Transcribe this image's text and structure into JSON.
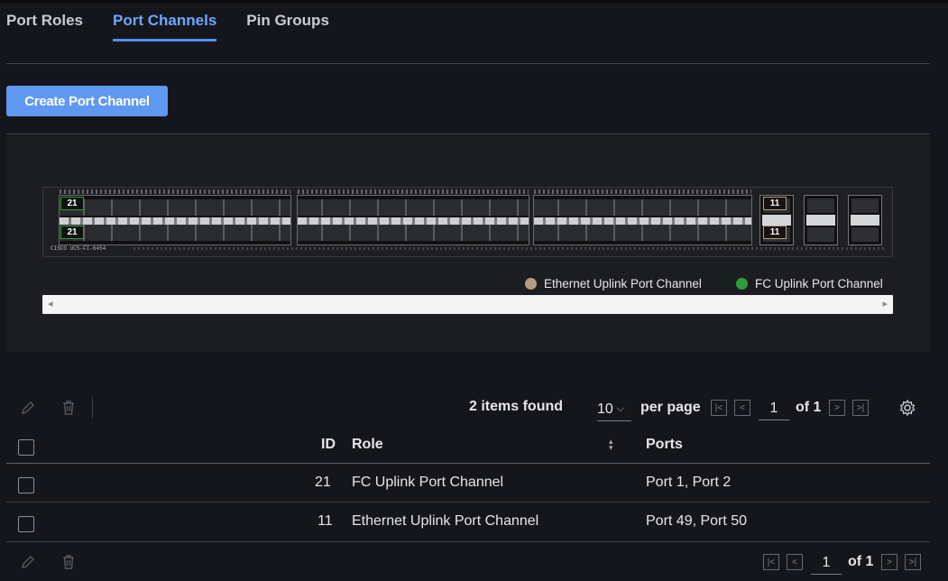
{
  "tabs": [
    {
      "label": "Port Roles",
      "active": false
    },
    {
      "label": "Port Channels",
      "active": true
    },
    {
      "label": "Pin Groups",
      "active": false
    }
  ],
  "create_button": "Create Port Channel",
  "switch": {
    "model": "CISCO UCS-FI-6454",
    "pc_tags": {
      "fc_top": "21",
      "fc_bottom": "21",
      "eth_top": "11",
      "eth_bottom": "11"
    }
  },
  "legend": [
    {
      "label": "Ethernet Uplink Port Channel",
      "color": "#b59c86"
    },
    {
      "label": "FC Uplink Port Channel",
      "color": "#2e9e3a"
    }
  ],
  "toolbar": {
    "items_found": "2 items found",
    "per_page_value": "10",
    "per_page_label": "per page",
    "page": "1",
    "of_pages": "of 1"
  },
  "table": {
    "headers": {
      "id": "ID",
      "role": "Role",
      "ports": "Ports"
    },
    "rows": [
      {
        "id": "21",
        "role": "FC Uplink Port Channel",
        "ports": "Port 1, Port 2"
      },
      {
        "id": "11",
        "role": "Ethernet Uplink Port Channel",
        "ports": "Port 49, Port 50"
      }
    ]
  },
  "footer": {
    "page": "1",
    "of_pages": "of 1"
  }
}
